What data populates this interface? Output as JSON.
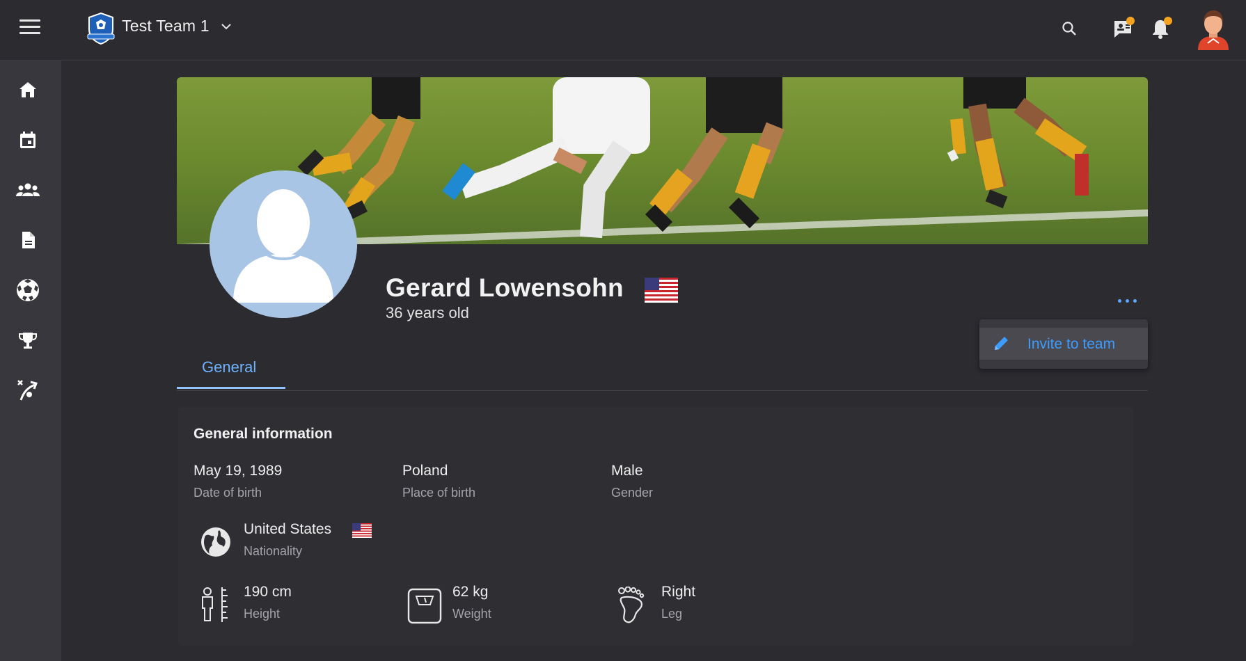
{
  "header": {
    "team_name": "Test Team 1",
    "icons": [
      "menu-icon",
      "team-logo",
      "chevron-down-icon",
      "search-icon",
      "messages-icon",
      "bell-icon",
      "user-avatar"
    ],
    "notification_color": "#f4a321"
  },
  "sidebar": {
    "items": [
      "home-icon",
      "calendar-icon",
      "team-icon",
      "document-icon",
      "football-icon",
      "trophy-icon",
      "tactics-icon"
    ]
  },
  "profile": {
    "name": "Gerard Lowensohn",
    "age": "36 years old",
    "flag": "us-flag-icon"
  },
  "menu": {
    "invite_label": "Invite to team"
  },
  "tabs": [
    {
      "label": "General",
      "active": true
    }
  ],
  "general": {
    "title": "General information",
    "dob": {
      "value": "May 19, 1989",
      "label": "Date of birth"
    },
    "pob": {
      "value": "Poland",
      "label": "Place of birth"
    },
    "gender": {
      "value": "Male",
      "label": "Gender"
    },
    "nationality": {
      "value": "United States",
      "label": "Nationality"
    },
    "height": {
      "value": "190 cm",
      "label": "Height"
    },
    "weight": {
      "value": "62 kg",
      "label": "Weight"
    },
    "leg": {
      "value": "Right",
      "label": "Leg"
    }
  },
  "colors": {
    "accent": "#3c9cff",
    "background": "#2c2b30",
    "sidebar": "#38373d"
  }
}
